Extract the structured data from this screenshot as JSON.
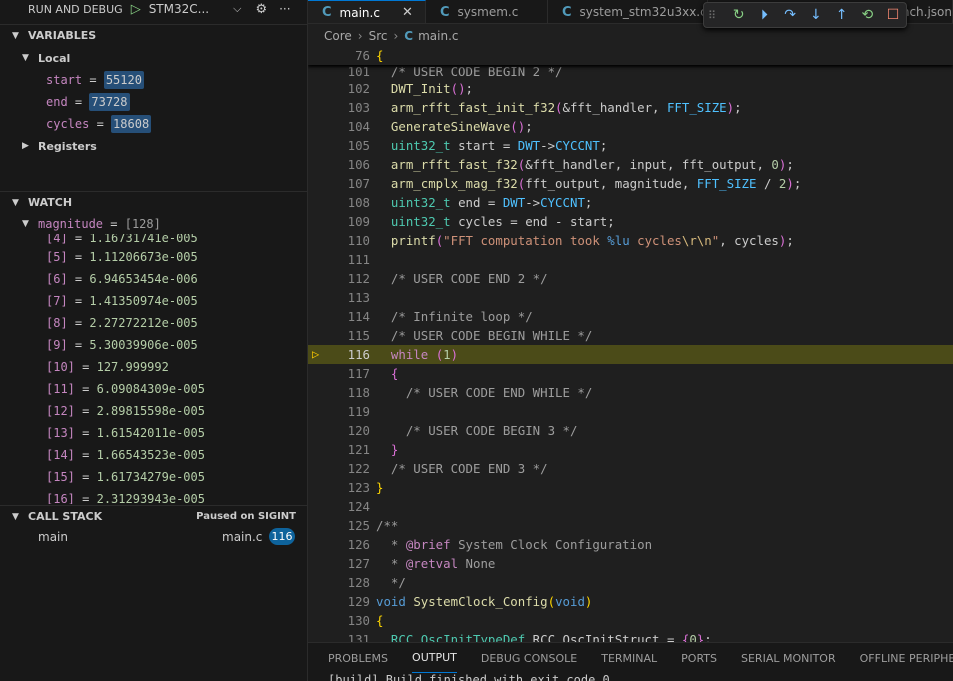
{
  "debug": {
    "title": "RUN AND DEBUG",
    "config": "STM32C...",
    "toolbar": [
      "restart-icon",
      "continue-icon",
      "step-over-icon",
      "step-into-icon",
      "step-out-icon",
      "reload-icon",
      "stop-icon"
    ]
  },
  "variables": {
    "title": "VARIABLES",
    "local_label": "Local",
    "locals": [
      {
        "name": "start",
        "value": "55120"
      },
      {
        "name": "end",
        "value": "73728"
      },
      {
        "name": "cycles",
        "value": "18608"
      }
    ],
    "registers_label": "Registers"
  },
  "watch": {
    "title": "WATCH",
    "expr": "magnitude",
    "expr_value": "[128]",
    "items": [
      {
        "index": "[4]",
        "value": "1.16731741e-005"
      },
      {
        "index": "[5]",
        "value": "1.11206673e-005"
      },
      {
        "index": "[6]",
        "value": "6.94653454e-006"
      },
      {
        "index": "[7]",
        "value": "1.41350974e-005"
      },
      {
        "index": "[8]",
        "value": "2.27272212e-005"
      },
      {
        "index": "[9]",
        "value": "5.30039906e-005"
      },
      {
        "index": "[10]",
        "value": "127.999992"
      },
      {
        "index": "[11]",
        "value": "6.09084309e-005"
      },
      {
        "index": "[12]",
        "value": "2.89815598e-005"
      },
      {
        "index": "[13]",
        "value": "1.61542011e-005"
      },
      {
        "index": "[14]",
        "value": "1.66543523e-005"
      },
      {
        "index": "[15]",
        "value": "1.61734279e-005"
      },
      {
        "index": "[16]",
        "value": "2.31293943e-005"
      }
    ]
  },
  "callstack": {
    "title": "CALL STACK",
    "status": "Paused on SIGINT",
    "frames": [
      {
        "name": "main",
        "file": "main.c",
        "line": "116"
      }
    ]
  },
  "tabs": [
    {
      "label": "main.c",
      "active": true
    },
    {
      "label": "sysmem.c",
      "active": false
    },
    {
      "label": "system_stm32u3xx.c",
      "active": false
    },
    {
      "label": "launch.json",
      "active": false
    }
  ],
  "breadcrumb": [
    "Core",
    "Src",
    "main.c"
  ],
  "editor": {
    "sticky_line": "76",
    "current_line": "116"
  },
  "panel": {
    "tabs": [
      "PROBLEMS",
      "OUTPUT",
      "DEBUG CONSOLE",
      "TERMINAL",
      "PORTS",
      "SERIAL MONITOR",
      "OFFLINE PERIPHERALS"
    ],
    "active": "OUTPUT",
    "output_line": "[build] Build finished with exit code 0"
  }
}
